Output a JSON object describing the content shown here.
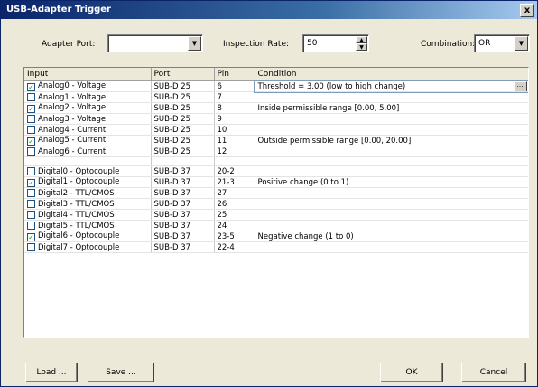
{
  "window": {
    "title": "USB-Adapter Trigger",
    "close_label": "x"
  },
  "toolbar": {
    "adapter_port_label": "Adapter Port:",
    "adapter_port_value": "",
    "inspection_rate_label": "Inspection Rate:",
    "inspection_rate_value": "50",
    "combination_label": "Combination:",
    "combination_value": "OR"
  },
  "grid": {
    "columns": [
      "Input",
      "Port",
      "Pin",
      "Condition"
    ],
    "rows": [
      {
        "checked": true,
        "input": "Analog0 - Voltage",
        "port": "SUB-D 25",
        "pin": "6",
        "condition": "Threshold = 3.00 (low to high change)",
        "editing": true
      },
      {
        "checked": false,
        "input": "Analog1 - Voltage",
        "port": "SUB-D 25",
        "pin": "7",
        "condition": ""
      },
      {
        "checked": true,
        "input": "Analog2 - Voltage",
        "port": "SUB-D 25",
        "pin": "8",
        "condition": "Inside permissible range [0.00, 5.00]"
      },
      {
        "checked": false,
        "input": "Analog3 - Voltage",
        "port": "SUB-D 25",
        "pin": "9",
        "condition": ""
      },
      {
        "checked": false,
        "input": "Analog4 - Current",
        "port": "SUB-D 25",
        "pin": "10",
        "condition": ""
      },
      {
        "checked": true,
        "input": "Analog5 - Current",
        "port": "SUB-D 25",
        "pin": "11",
        "condition": "Outside permissible range [0.00, 20.00]"
      },
      {
        "checked": false,
        "input": "Analog6 - Current",
        "port": "SUB-D 25",
        "pin": "12",
        "condition": ""
      },
      {
        "spacer": true
      },
      {
        "checked": false,
        "input": "Digital0 - Optocouple",
        "port": "SUB-D 37",
        "pin": "20-2",
        "condition": ""
      },
      {
        "checked": true,
        "input": "Digital1 - Optocouple",
        "port": "SUB-D 37",
        "pin": "21-3",
        "condition": "Positive change (0 to 1)"
      },
      {
        "checked": false,
        "input": "Digital2 - TTL/CMOS",
        "port": "SUB-D 37",
        "pin": "27",
        "condition": ""
      },
      {
        "checked": false,
        "input": "Digital3 - TTL/CMOS",
        "port": "SUB-D 37",
        "pin": "26",
        "condition": ""
      },
      {
        "checked": false,
        "input": "Digital4 - TTL/CMOS",
        "port": "SUB-D 37",
        "pin": "25",
        "condition": ""
      },
      {
        "checked": false,
        "input": "Digital5 - TTL/CMOS",
        "port": "SUB-D 37",
        "pin": "24",
        "condition": ""
      },
      {
        "checked": true,
        "input": "Digital6 - Optocouple",
        "port": "SUB-D 37",
        "pin": "23-5",
        "condition": "Negative change (1 to 0)"
      },
      {
        "checked": false,
        "input": "Digital7 - Optocouple",
        "port": "SUB-D 37",
        "pin": "22-4",
        "condition": ""
      }
    ]
  },
  "buttons": {
    "load": "Load ...",
    "save": "Save ...",
    "ok": "OK",
    "cancel": "Cancel"
  },
  "icons": {
    "checkbox": "checkmark-icon",
    "dropdown": "chevron-down-icon",
    "ellipsis": "ellipsis-icon"
  }
}
